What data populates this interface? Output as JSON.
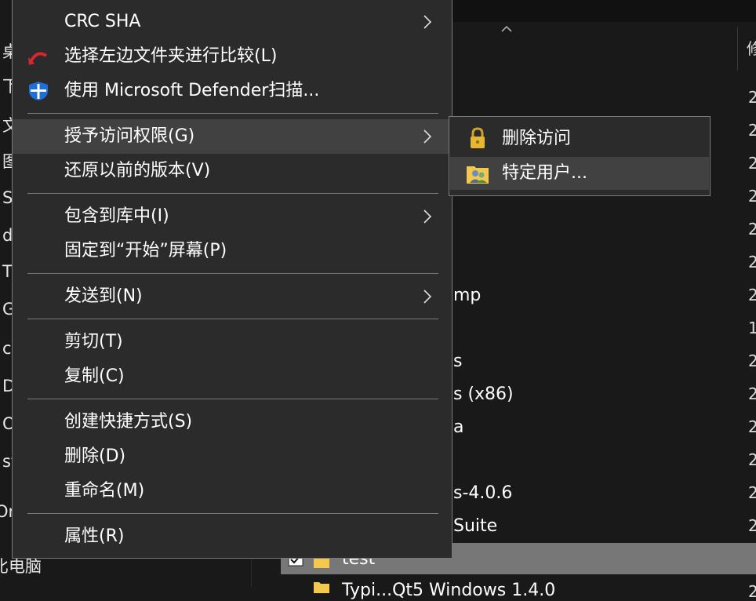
{
  "nav": {
    "items": [
      "桌",
      "下",
      "文",
      "图",
      "S",
      "d",
      "T",
      "G",
      "c",
      "D",
      "O",
      "st",
      "Or",
      "比电脑"
    ]
  },
  "content": {
    "column_header": "修",
    "dates": [
      "2",
      "2",
      "2",
      "2",
      "2",
      "2",
      "2",
      "1",
      "2",
      "2",
      "2",
      "2",
      "2",
      "2",
      "2",
      "2"
    ],
    "partial_names": [
      "mp",
      "s",
      "s (x86)",
      "a",
      "s-4.0.6",
      "Suite",
      "test",
      "Typi...Qt5 Windows 1.4.0"
    ]
  },
  "context_menu": {
    "crc_sha": "CRC SHA",
    "compare_left": "选择左边文件夹进行比较(L)",
    "defender_scan": "使用 Microsoft Defender扫描...",
    "give_access": "授予访问权限(G)",
    "restore_versions": "还原以前的版本(V)",
    "include_library": "包含到库中(I)",
    "pin_start": "固定到“开始”屏幕(P)",
    "send_to": "发送到(N)",
    "cut": "剪切(T)",
    "copy": "复制(C)",
    "create_shortcut": "创建快捷方式(S)",
    "delete": "删除(D)",
    "rename": "重命名(M)",
    "properties": "属性(R)"
  },
  "submenu": {
    "remove_access": "删除访问",
    "specific_people": "特定用户..."
  },
  "colors": {
    "menu_bg": "#2b2b2b",
    "menu_highlight": "#414141",
    "menu_border": "#7a7a7a",
    "selection_row": "#777777",
    "defender_blue": "#1e6fd9",
    "lock_gold": "#e8b732",
    "compare_red": "#d8262c"
  },
  "icons": {
    "compare": "red-curved-arrow-icon",
    "defender": "defender-shield-icon",
    "remove_access": "padlock-icon",
    "specific_people": "users-folder-icon",
    "submenu_arrow": "chevron-right-icon"
  }
}
